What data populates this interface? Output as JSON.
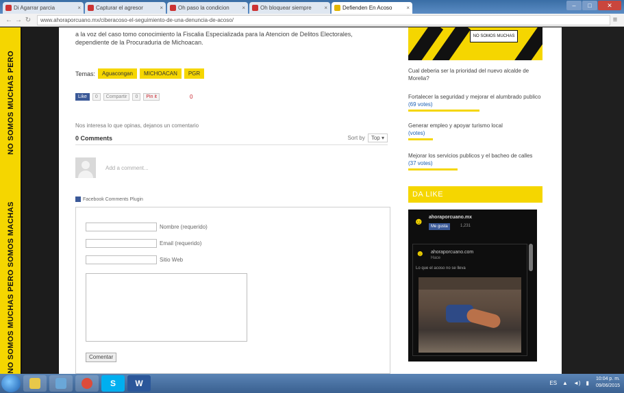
{
  "browser": {
    "tabs": [
      {
        "label": "Di Agarrar parcia",
        "active": false
      },
      {
        "label": "Capturar el agresor",
        "active": false
      },
      {
        "label": "Oh paso la condicion",
        "active": false
      },
      {
        "label": "Oh bloquear siempre",
        "active": false
      },
      {
        "label": "Defienden En Acoso",
        "active": true
      }
    ],
    "url": "www.ahoraporcuano.mx/ciberacoso-el-seguimiento-de-una-denuncia-de-acoso/",
    "back_icon": "back-arrow-icon",
    "forward_icon": "forward-arrow-icon",
    "reload_icon": "reload-icon",
    "menu_icon": "menu-icon"
  },
  "tape": {
    "text_top": "NO SOMOS MUCHAS PERO",
    "text_bottom": "NO SOMOS MUCHAS PERO SOMOS MACHAS",
    "color": "#f5d600"
  },
  "article": {
    "paragraph_line1": "a la voz del caso tomo conocimiento la Fiscalia Especializada para la Atencion de Delitos Electorales,",
    "paragraph_line2": "dependiente de la Procuraduria de Michoacan."
  },
  "tags": {
    "label": "Temas:",
    "items": [
      "Aguacongan",
      "MICHOACAN",
      "PGR"
    ]
  },
  "share": {
    "fb_label": "Like",
    "fb_count": "0",
    "gplus_label": "Compartir",
    "gplus_count": "0",
    "pin_label": "Pin it",
    "count_red": "0"
  },
  "comments": {
    "note": "Nos interesa lo que opinas, dejanos un comentario",
    "count_label": "0 Comments",
    "sort_label": "Sort by",
    "sort_value": "Top",
    "add_placeholder": "Add a comment...",
    "fb_plugin_label": "Facebook Comments Plugin"
  },
  "form": {
    "name_label": "Nombre (requerido)",
    "email_label": "Email (requerido)",
    "website_label": "Sitio Web",
    "submit_label": "Comentar"
  },
  "sidebar": {
    "banner_mark": "NO SOMOS MUCHAS",
    "q_line1": "Cual deberia ser la prioridad del nuevo alcalde de",
    "q_line2": "Morelia?",
    "items": [
      {
        "text": "Fortalecer la seguridad y mejorar el alumbrado publico",
        "meta": "(69 votes)"
      },
      {
        "text": "Generar empleo y apoyar turismo local",
        "meta": "(votes)"
      },
      {
        "text": "Mejorar los servicios publicos y el bacheo de calles",
        "meta": "(37 votes)"
      }
    ],
    "dalike_title": "DA LIKE",
    "fb": {
      "page_name": "ahoraporcuano.mx",
      "like_button": "Me gusta",
      "like_count": "1,231",
      "post_title": "ahoraporcuano.com",
      "post_date": "Hace",
      "post_text": "Lo que el acoso no se lleva"
    }
  },
  "taskbar": {
    "apps": [
      {
        "name": "explorer",
        "color": "#e8c84a"
      },
      {
        "name": "media",
        "color": "#6aa7d8"
      },
      {
        "name": "chrome",
        "color": "#dd4b39"
      },
      {
        "name": "skype",
        "color": "#00aff0",
        "letter": "S"
      },
      {
        "name": "word",
        "color": "#2b579a",
        "letter": "W"
      }
    ],
    "tray_lang": "ES",
    "time": "10:04 p. m.",
    "date": "09/06/2015"
  }
}
